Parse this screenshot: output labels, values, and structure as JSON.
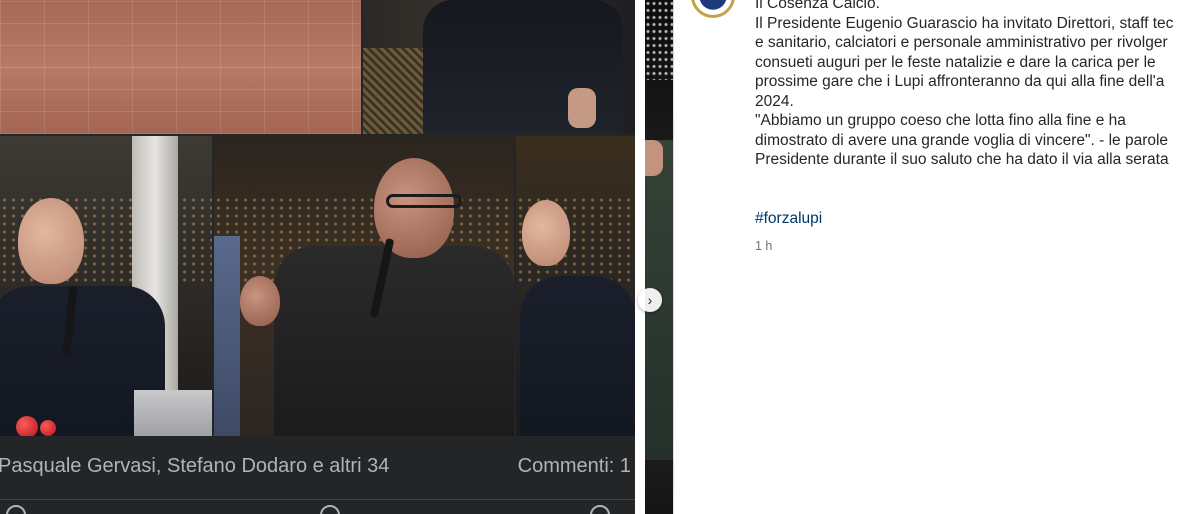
{
  "fb_post": {
    "reactions_text": "Pasquale Gervasi, Stefano Dodaro e altri 34",
    "comments_text": "Commenti: 1"
  },
  "ig_post": {
    "caption_lines": [
      "Il Cosenza Calcio.",
      "Il Presidente Eugenio Guarascio ha invitato Direttori, staff tec",
      "e sanitario, calciatori e personale amministrativo per rivolger",
      "consueti auguri per le feste natalizie e dare la carica per le",
      "prossime gare che i Lupi affronteranno da qui alla fine dell'a",
      "2024.",
      "\"Abbiamo un gruppo coeso che lotta fino alla fine e ha",
      "dimostrato di avere una grande voglia di vincere\". - le parole",
      "Presidente durante il suo saluto che ha dato il via alla serata"
    ],
    "hashtag": "#forzalupi",
    "time": "1 h",
    "carousel_arrow": "›"
  }
}
